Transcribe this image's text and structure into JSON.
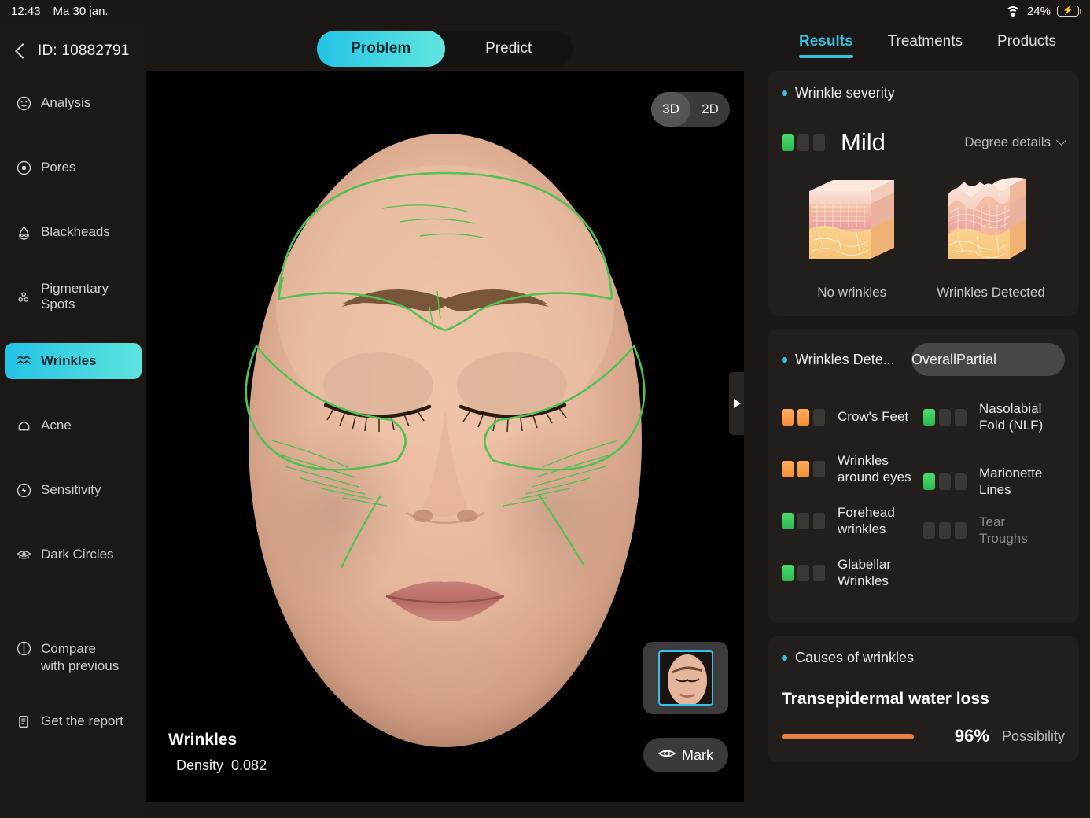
{
  "status": {
    "time": "12:43",
    "date": "Ma 30 jan.",
    "battery_pct": "24%",
    "wifi_icon": "wifi-icon",
    "battery_icon": "battery-charging-icon"
  },
  "header": {
    "back_icon": "chevron-left-icon",
    "id_label": "ID: 10882791"
  },
  "sidebar": {
    "items": [
      {
        "label": "Analysis",
        "icon": "smiley-face-icon",
        "active": false
      },
      {
        "label": "Pores",
        "icon": "pore-circle-icon",
        "active": false
      },
      {
        "label": "Blackheads",
        "icon": "nose-icon",
        "active": false
      },
      {
        "label": "Pigmentary Spots",
        "icon": "spots-icon",
        "active": false
      },
      {
        "label": "Wrinkles",
        "icon": "wave-lines-icon",
        "active": true
      },
      {
        "label": "Acne",
        "icon": "acne-bump-icon",
        "active": false
      },
      {
        "label": "Sensitivity",
        "icon": "lightning-circle-icon",
        "active": false
      },
      {
        "label": "Dark Circles",
        "icon": "eye-layers-icon",
        "active": false
      }
    ],
    "bottom_items": [
      {
        "label": "Compare\nwith previous",
        "line1": "Compare",
        "line2": "with previous",
        "icon": "compare-contrast-icon"
      },
      {
        "label": "Get the report",
        "line1": "Get the report",
        "line2": "",
        "icon": "document-icon"
      }
    ]
  },
  "mode_toggle": {
    "options": [
      "Problem",
      "Predict"
    ],
    "selected": "Problem"
  },
  "viewer": {
    "dimension_toggle": {
      "options": [
        "3D",
        "2D"
      ],
      "selected": "3D"
    },
    "overlay_title": "Wrinkles",
    "overlay_metric_label": "Density",
    "overlay_metric_value": "0.082",
    "mark_button": "Mark",
    "mark_icon": "eye-icon",
    "thumbnail_name": "face-thumbnail",
    "expand_icon": "triangle-right-icon",
    "annotation_color": "#4fc24f"
  },
  "right_panel": {
    "tabs": [
      {
        "label": "Results",
        "active": true
      },
      {
        "label": "Treatments",
        "active": false
      },
      {
        "label": "Products",
        "active": false
      }
    ],
    "severity_card": {
      "title": "Wrinkle severity",
      "level": "Mild",
      "level_filled": 1,
      "level_total": 3,
      "level_color": "#3ecf5c",
      "degree_details": "Degree details",
      "chevron_icon": "chevron-down-icon",
      "diagrams": [
        {
          "caption": "No wrinkles",
          "name": "skin-cross-section-smooth"
        },
        {
          "caption": "Wrinkles Detected",
          "name": "skin-cross-section-wrinkled"
        }
      ]
    },
    "detected_card": {
      "title": "Wrinkles Dete...",
      "scope_toggle": {
        "options": [
          "Overall",
          "Partial"
        ],
        "selected": "Overall"
      },
      "left_items": [
        {
          "label": "Crow's Feet",
          "filled": 2,
          "color": "orange"
        },
        {
          "label": "Wrinkles around eyes",
          "filled": 2,
          "color": "orange"
        },
        {
          "label": "Forehead wrinkles",
          "filled": 1,
          "color": "green"
        },
        {
          "label": "Glabellar Wrinkles",
          "filled": 1,
          "color": "green"
        }
      ],
      "right_items": [
        {
          "label": "Nasolabial Fold (NLF)",
          "filled": 1,
          "color": "green",
          "dim": false
        },
        {
          "label": "Marionette Lines",
          "filled": 1,
          "color": "green",
          "dim": false
        },
        {
          "label": "Tear Troughs",
          "filled": 0,
          "color": "none",
          "dim": true
        }
      ]
    },
    "causes_card": {
      "title": "Causes of wrinkles",
      "cause_name": "Transepidermal water loss",
      "percent": "96%",
      "percent_label": "Possibility",
      "bar_color": "#e8813f"
    }
  }
}
